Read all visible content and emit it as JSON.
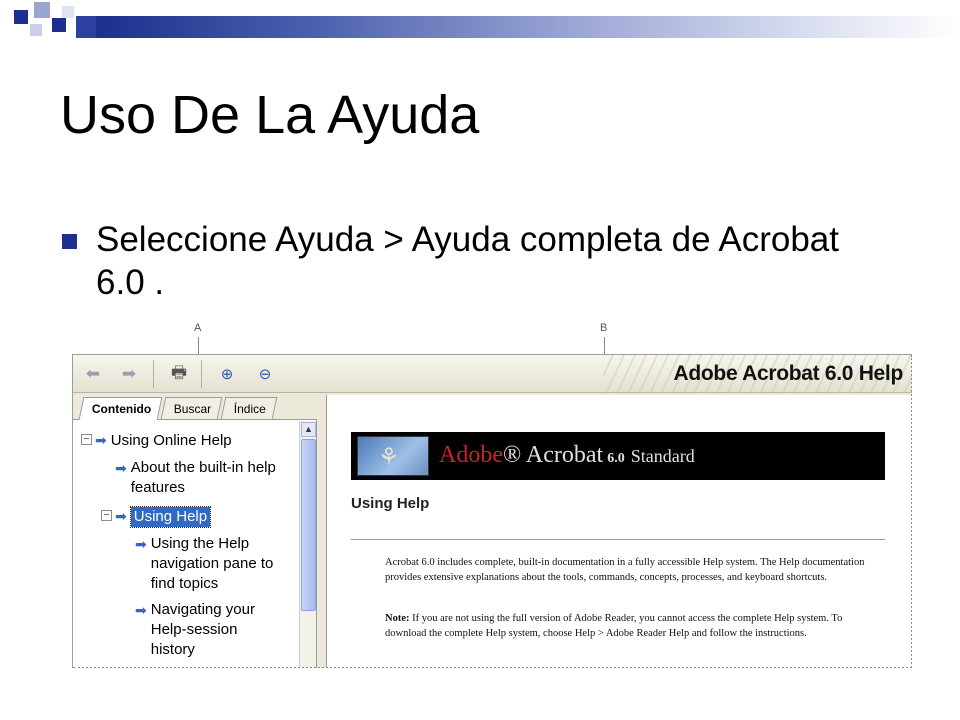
{
  "slide": {
    "title": "Uso De La Ayuda",
    "bullet": "Seleccione Ayuda > Ayuda completa de Acrobat 6.0 .",
    "accent_color": "#1d2f8c"
  },
  "callouts": {
    "a": "A",
    "b": "B"
  },
  "help_window": {
    "toolbar": {
      "brand": "Adobe Acrobat 6.0 Help",
      "icons": [
        "back-arrow-icon",
        "forward-arrow-icon",
        "print-icon",
        "zoom-in-icon",
        "zoom-out-icon"
      ]
    },
    "tabs": [
      "Contenido",
      "Buscar",
      "Índice"
    ],
    "tree": [
      {
        "label": "Using Online Help",
        "expander": "⊟"
      },
      {
        "label": "About the built-in help\nfeatures"
      },
      {
        "label": "Using Help",
        "expander": "⊟",
        "selected": true
      },
      {
        "label": "Using the Help\nnavigation pane to\nfind topics"
      },
      {
        "label": "Navigating your\nHelp-session\nhistory"
      }
    ],
    "content": {
      "banner": {
        "adobe": "Adobe",
        "acrobat": "Acrobat",
        "version": "6.0",
        "edition": "Standard"
      },
      "heading": "Using Help",
      "para1": "Acrobat 6.0 includes complete, built-in documentation in a fully accessible Help system. The Help documentation provides extensive explanations about the tools, commands, concepts, processes, and keyboard shortcuts.",
      "note_label": "Note:",
      "note_text": " If you are not using the full version of Adobe Reader, you cannot access the complete Help system. To download the complete Help system, choose Help > Adobe Reader Help and follow the instructions."
    }
  }
}
